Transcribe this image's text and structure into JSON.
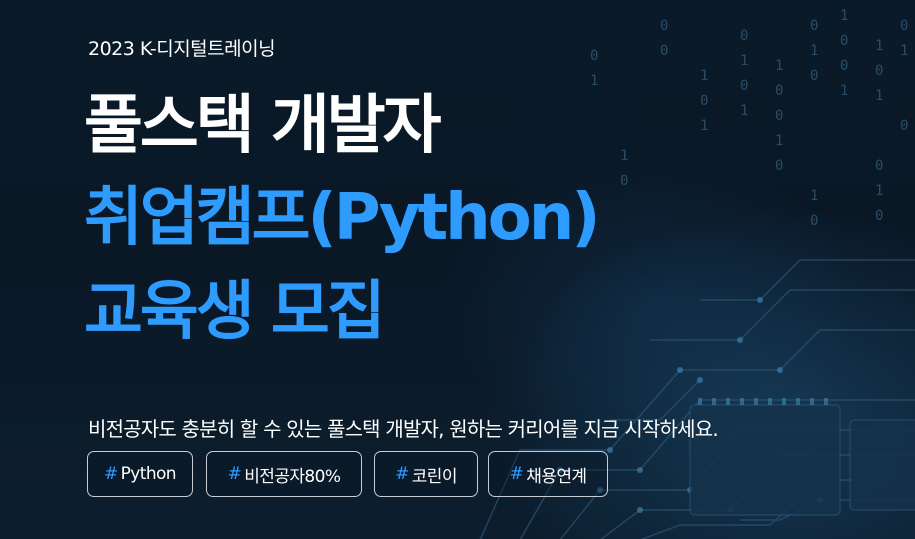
{
  "banner": {
    "eyebrow": "2023 K-디지털트레이닝",
    "title_lines": [
      "풀스택 개발자",
      "취업캠프(Python)",
      "교육생 모집"
    ],
    "subtitle": "비전공자도 충분히 할 수 있는 풀스택 개발자, 원하는 커리어를 지금 시작하세요.",
    "tags": [
      {
        "hash": "#",
        "label": "Python"
      },
      {
        "hash": "#",
        "label": "비전공자80%"
      },
      {
        "hash": "#",
        "label": "코린이"
      },
      {
        "hash": "#",
        "label": "채용연계"
      }
    ]
  },
  "colors": {
    "background": "#0a1826",
    "accent": "#2e9bff",
    "text": "#ffffff",
    "tag_border": "#c7cdd4"
  },
  "background_art": {
    "description_icon": "circuit-board-binary-code-image"
  }
}
